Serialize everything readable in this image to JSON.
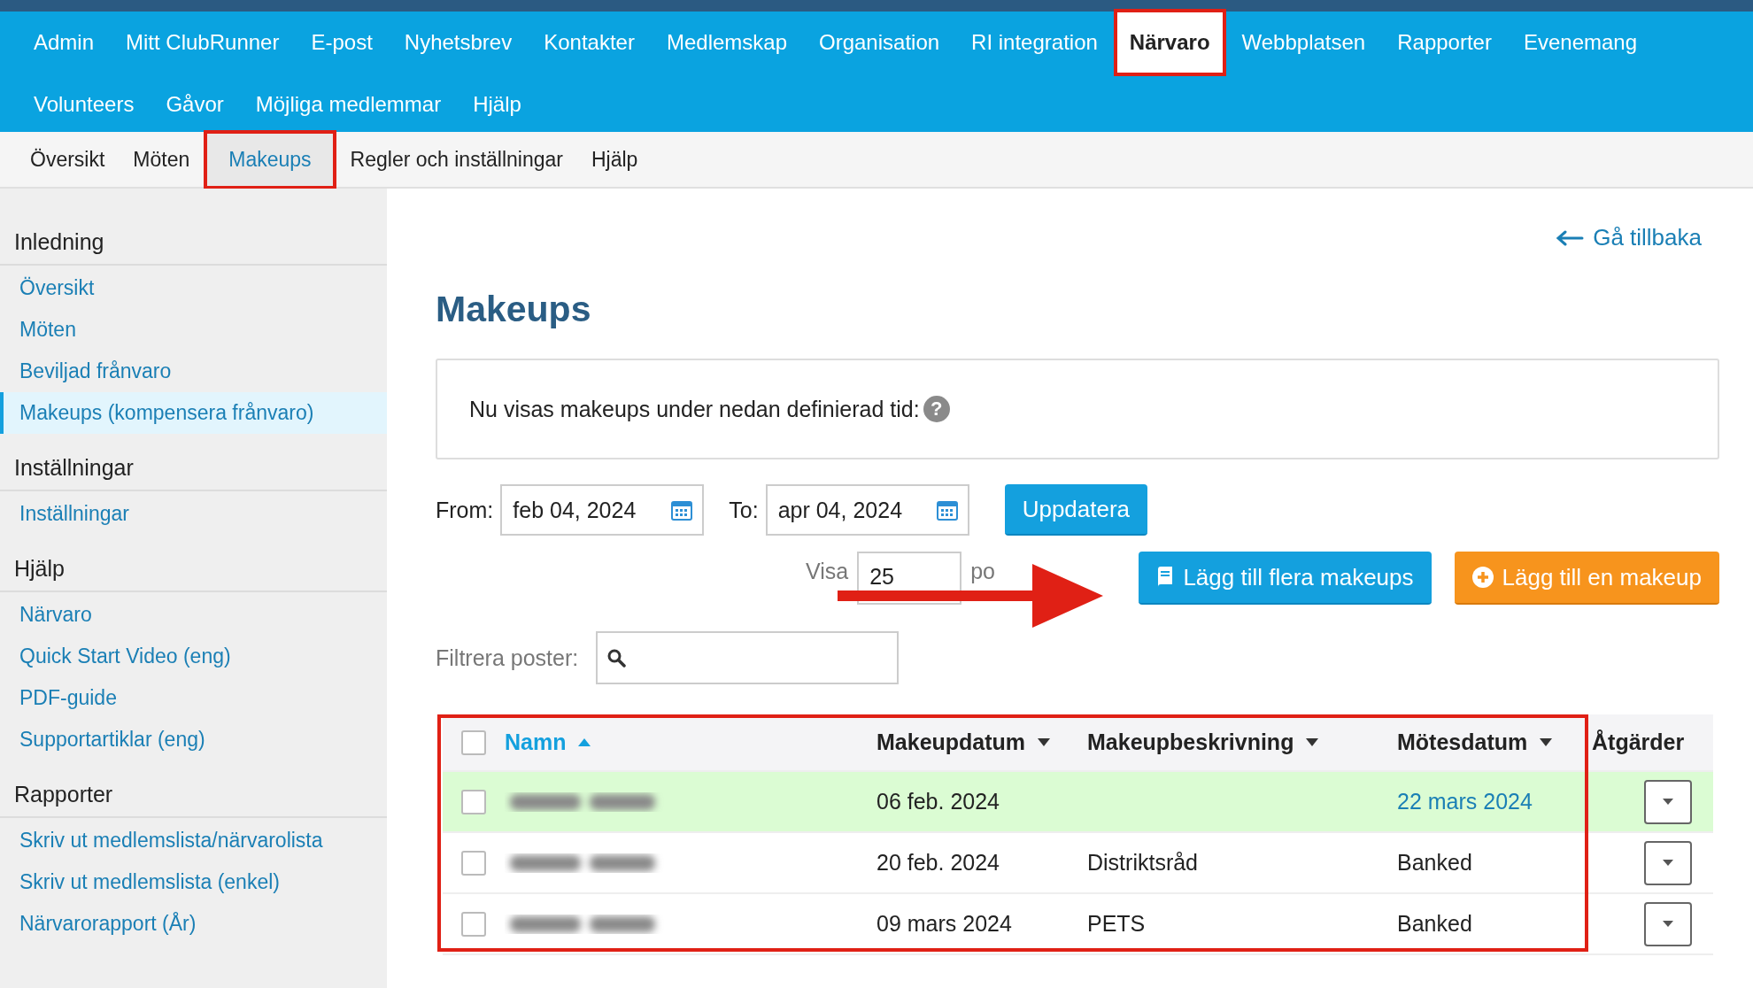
{
  "top_nav": {
    "rows": [
      [
        {
          "label": "Admin",
          "selected": false
        },
        {
          "label": "Mitt ClubRunner",
          "selected": false
        },
        {
          "label": "E-post",
          "selected": false
        },
        {
          "label": "Nyhetsbrev",
          "selected": false
        },
        {
          "label": "Kontakter",
          "selected": false
        },
        {
          "label": "Medlemskap",
          "selected": false
        },
        {
          "label": "Organisation",
          "selected": false
        },
        {
          "label": "RI integration",
          "selected": false
        },
        {
          "label": "Närvaro",
          "selected": true
        },
        {
          "label": "Webbplatsen",
          "selected": false
        },
        {
          "label": "Rapporter",
          "selected": false
        },
        {
          "label": "Evenemang",
          "selected": false
        }
      ],
      [
        {
          "label": "Volunteers",
          "selected": false
        },
        {
          "label": "Gåvor",
          "selected": false
        },
        {
          "label": "Möjliga medlemmar",
          "selected": false
        },
        {
          "label": "Hjälp",
          "selected": false
        }
      ]
    ]
  },
  "sub_nav": [
    {
      "label": "Översikt",
      "selected": false
    },
    {
      "label": "Möten",
      "selected": false
    },
    {
      "label": "Makeups",
      "selected": true
    },
    {
      "label": "Regler och inställningar",
      "selected": false
    },
    {
      "label": "Hjälp",
      "selected": false
    }
  ],
  "sidebar": {
    "sections": [
      {
        "heading": "Inledning",
        "items": [
          {
            "label": "Översikt",
            "selected": false
          },
          {
            "label": "Möten",
            "selected": false
          },
          {
            "label": "Beviljad frånvaro",
            "selected": false
          },
          {
            "label": "Makeups (kompensera frånvaro)",
            "selected": true
          }
        ]
      },
      {
        "heading": "Inställningar",
        "items": [
          {
            "label": "Inställningar",
            "selected": false
          }
        ]
      },
      {
        "heading": "Hjälp",
        "items": [
          {
            "label": "Närvaro",
            "selected": false
          },
          {
            "label": "Quick Start Video (eng)",
            "selected": false
          },
          {
            "label": "PDF-guide",
            "selected": false
          },
          {
            "label": "Supportartiklar (eng)",
            "selected": false
          }
        ]
      },
      {
        "heading": "Rapporter",
        "items": [
          {
            "label": "Skriv ut medlemslista/närvarolista",
            "selected": false
          },
          {
            "label": "Skriv ut medlemslista (enkel)",
            "selected": false
          },
          {
            "label": "Närvarorapport (År)",
            "selected": false
          }
        ]
      }
    ]
  },
  "back_link": "Gå tillbaka",
  "page_title": "Makeups",
  "info_box": {
    "text": "Nu visas makeups under nedan definierad tid:",
    "help_glyph": "?"
  },
  "date_range": {
    "from_label": "From:",
    "from_value": "feb 04, 2024",
    "to_label": "To:",
    "to_value": "apr 04, 2024",
    "update_button": "Uppdatera"
  },
  "page_size": {
    "label": "Visa",
    "value": "25",
    "suffix": "po"
  },
  "buttons": [
    {
      "label": "Lägg till flera makeups",
      "kind": "primary"
    },
    {
      "label": "Lägg till en makeup",
      "kind": "warning"
    }
  ],
  "filter": {
    "label": "Filtrera poster:"
  },
  "table": {
    "header_checked": false,
    "columns": [
      {
        "label": "Namn",
        "sorted_ascending": true,
        "sort_menu": false
      },
      {
        "label": "Makeupdatum",
        "sorted_ascending": false,
        "sort_menu": true
      },
      {
        "label": "Makeupbeskrivning",
        "sorted_ascending": false,
        "sort_menu": true
      },
      {
        "label": "Mötesdatum",
        "sorted_ascending": false,
        "sort_menu": true
      },
      {
        "label": "Åtgärder",
        "sorted_ascending": false,
        "sort_menu": false
      }
    ],
    "rows": [
      {
        "checked": false,
        "highlighted": true,
        "name_redacted": true,
        "makeup_date": "06 feb. 2024",
        "meeting_date": "22 mars 2024",
        "meeting_link": true
      },
      {
        "checked": false,
        "highlighted": false,
        "name_redacted": true,
        "makeup_date": "20 feb. 2024",
        "description": "Distriktsråd",
        "meeting_date": "Banked",
        "meeting_link": false
      },
      {
        "checked": false,
        "highlighted": false,
        "name_redacted": true,
        "makeup_date": "09 mars 2024",
        "description": "PETS",
        "meeting_date": "Banked",
        "meeting_link": false
      }
    ]
  },
  "annotations": {
    "table_frame": true,
    "arrow": true
  }
}
